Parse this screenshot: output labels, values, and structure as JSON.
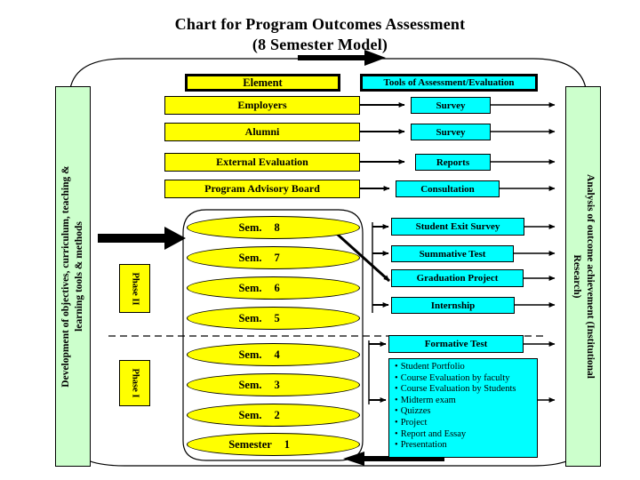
{
  "title": {
    "line1": "Chart for Program Outcomes Assessment",
    "line2": "(8 Semester Model)"
  },
  "colors": {
    "yellow": "#FFFF00",
    "cyan": "#00FFFF",
    "green": "#CCFFCC",
    "outline": "#000000",
    "background": "#FFFFFF"
  },
  "side_panels": {
    "left": {
      "line1": "Development of objectives, curriculum, teaching &",
      "line2": "learning tools & methods"
    },
    "right": {
      "line1": "Analysis of outcome achievement (Institutional",
      "line2": "Research)"
    }
  },
  "headers": {
    "element": "Element",
    "tools": "Tools of Assessment/Evaluation"
  },
  "element_rows": [
    {
      "element": "Employers",
      "tool": "Survey"
    },
    {
      "element": "Alumni",
      "tool": "Survey"
    },
    {
      "element": "External Evaluation",
      "tool": "Reports"
    },
    {
      "element": "Program Advisory Board",
      "tool": "Consultation"
    }
  ],
  "phases": [
    {
      "label": "Phase II"
    },
    {
      "label": "Phase I"
    }
  ],
  "semesters": [
    {
      "label": "Sem.",
      "number": "8"
    },
    {
      "label": "Sem.",
      "number": "7"
    },
    {
      "label": "Sem.",
      "number": "6"
    },
    {
      "label": "Sem.",
      "number": "5"
    },
    {
      "label": "Sem.",
      "number": "4"
    },
    {
      "label": "Sem.",
      "number": "3"
    },
    {
      "label": "Sem.",
      "number": "2"
    },
    {
      "label": "Semester",
      "number": "1"
    }
  ],
  "phase2_tools": [
    "Student Exit Survey",
    "Summative Test",
    "Graduation Project",
    "Internship"
  ],
  "phase1_tools": {
    "formative_test": "Formative Test",
    "items": [
      "Student Portfolio",
      "Course Evaluation   by faculty",
      "Course Evaluation by Students",
      "Midterm exam",
      "Quizzes",
      "Project",
      "Report and Essay",
      "Presentation"
    ]
  }
}
